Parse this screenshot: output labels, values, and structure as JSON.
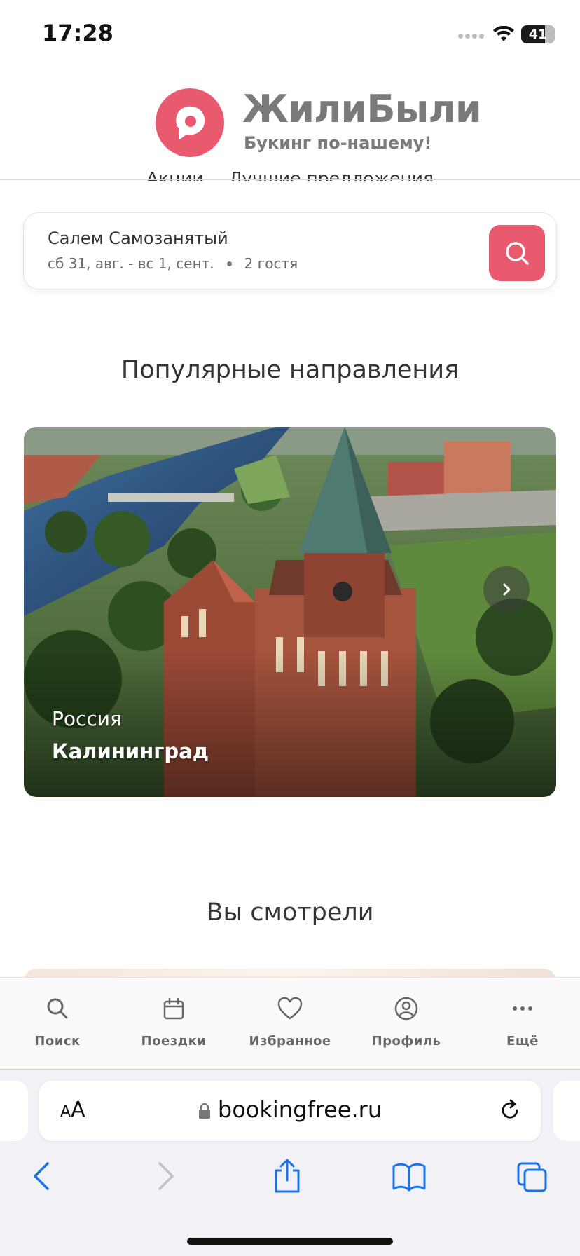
{
  "status": {
    "time": "17:28",
    "battery": "41"
  },
  "brand": {
    "name": "ЖилиБыли",
    "tagline": "Букинг по-нашему!"
  },
  "subnav": {
    "items": [
      "Акции",
      "Лучшие предложения"
    ]
  },
  "search": {
    "guest_name": "Салем Самозанятый",
    "dates": "сб 31, авг. - вс 1, сент.",
    "guests": "2 гостя"
  },
  "popular": {
    "title": "Популярные направления",
    "card": {
      "country": "Россия",
      "city": "Калининград"
    }
  },
  "viewed": {
    "title": "Вы смотрели"
  },
  "tabbar": {
    "search": "Поиск",
    "trips": "Поездки",
    "favorites": "Избранное",
    "profile": "Профиль",
    "more": "Ещё"
  },
  "browser": {
    "aa_small": "A",
    "aa_big": "A",
    "url": "bookingfree.ru"
  },
  "colors": {
    "accent": "#ea5a6f",
    "ios_blue": "#1a73e8"
  },
  "icons": [
    "search-icon",
    "calendar-icon",
    "heart-icon",
    "user-circle-icon",
    "more-icon",
    "lock-icon",
    "reload-icon",
    "back-icon",
    "forward-icon",
    "share-icon",
    "bookmarks-icon",
    "tabs-icon",
    "chevron-right-icon"
  ]
}
